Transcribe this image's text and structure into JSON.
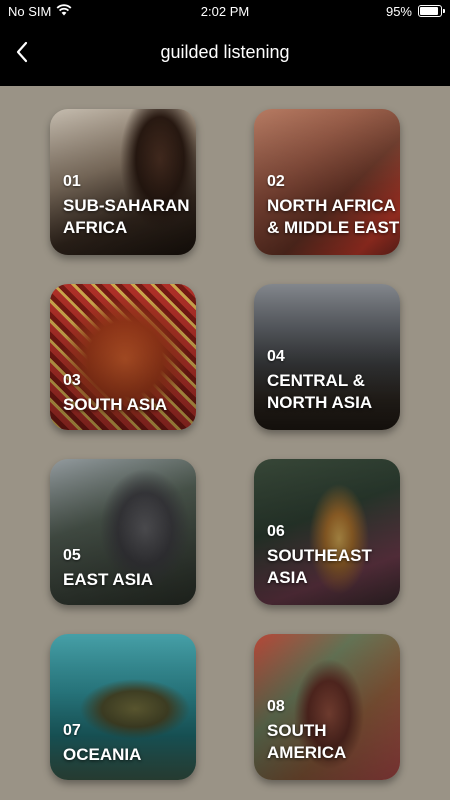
{
  "status_bar": {
    "carrier": "No SIM",
    "time": "2:02 PM",
    "battery_percent": "95%",
    "battery_level": 0.95
  },
  "nav": {
    "back_icon": "chevron-left-icon",
    "title": "guilded listening"
  },
  "regions": [
    {
      "number": "01",
      "name": "SUB-SAHARAN\nAFRICA"
    },
    {
      "number": "02",
      "name": "NORTH AFRICA\n& MIDDLE EAST"
    },
    {
      "number": "03",
      "name": "SOUTH ASIA"
    },
    {
      "number": "04",
      "name": "CENTRAL &\nNORTH ASIA"
    },
    {
      "number": "05",
      "name": "EAST ASIA"
    },
    {
      "number": "06",
      "name": "SOUTHEAST\nASIA"
    },
    {
      "number": "07",
      "name": "OCEANIA"
    },
    {
      "number": "08",
      "name": "SOUTH\nAMERICA"
    }
  ]
}
